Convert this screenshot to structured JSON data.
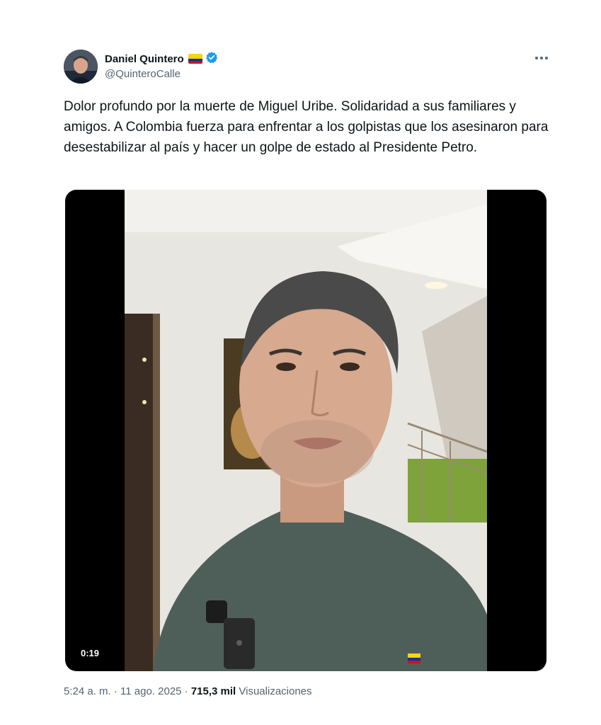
{
  "author": {
    "display_name": "Daniel Quintero",
    "handle": "@QuinteroCalle",
    "flag_icon": "colombia-flag-icon",
    "verified_icon": "verified-badge-icon",
    "verified_color": "#1d9bf0"
  },
  "tweet": {
    "text": "Dolor profundo por la muerte de Miguel Uribe. Solidaridad a sus familiares y amigos. A Colombia fuerza para enfrentar a los golpistas que los asesinaron para desestabilizar al país y hacer un golpe de estado al Presidente Petro."
  },
  "video": {
    "duration": "0:19"
  },
  "meta": {
    "timestamp": "5:24 a. m. · 11 ago. 2025 · ",
    "views_count": "715,3 mil",
    "views_label": " Visualizaciones"
  },
  "colors": {
    "text_primary": "#0f1419",
    "text_secondary": "#536471"
  }
}
